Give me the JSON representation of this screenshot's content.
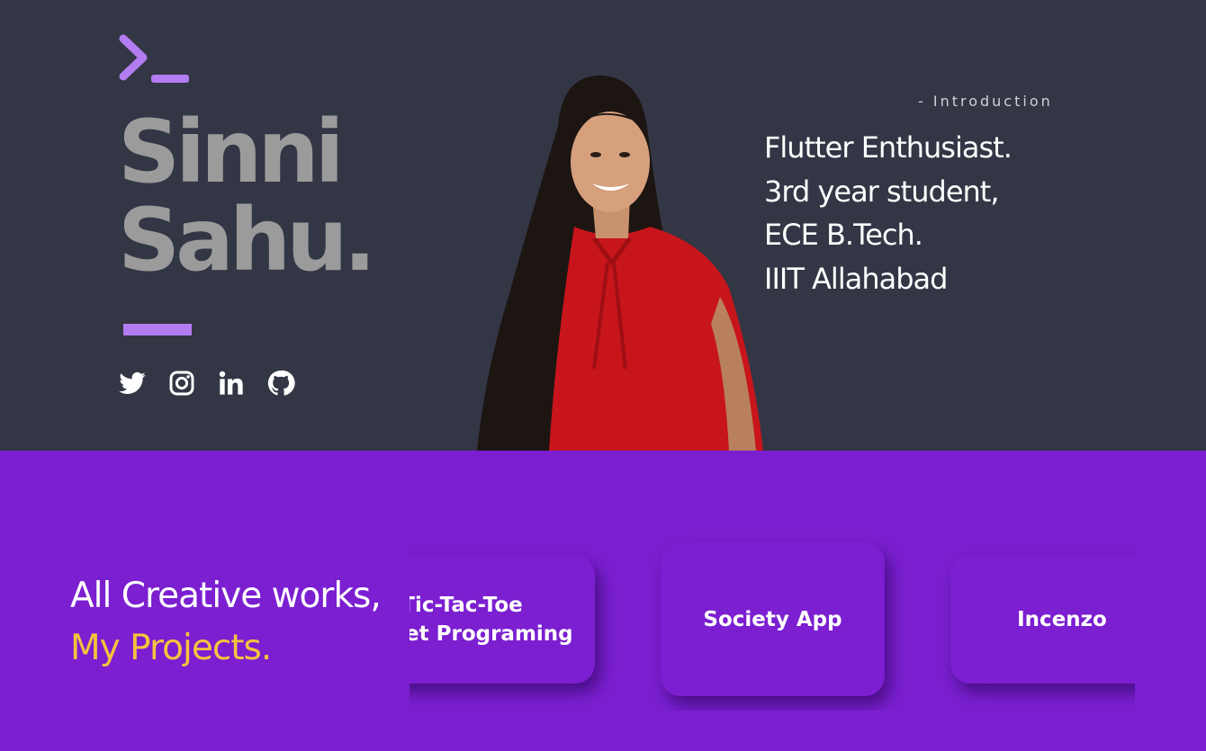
{
  "hero": {
    "name_line1": "Sinni",
    "name_line2": "Sahu.",
    "intro_label": "- Introduction",
    "intro_lines": [
      "Flutter Enthusiast.",
      "3rd year student,",
      "ECE B.Tech.",
      "IIIT Allahabad"
    ],
    "socials": [
      {
        "icon": "twitter-icon"
      },
      {
        "icon": "instagram-icon"
      },
      {
        "icon": "linkedin-icon"
      },
      {
        "icon": "github-icon"
      }
    ]
  },
  "projects": {
    "heading_line1": "All Creative works,",
    "heading_line2": "My Projects.",
    "cards": [
      {
        "title_line1": "Tic-Tac-Toe",
        "title_line2": "Socket Programing"
      },
      {
        "title_line1": "Society App"
      },
      {
        "title_line1": "Incenzo"
      }
    ]
  },
  "colors": {
    "hero_background": "#333645",
    "projects_background": "#7b1fd1",
    "accent_purple": "#b37cf0",
    "name_gray": "#9b9b9b",
    "highlight_yellow": "#f6c23e"
  }
}
